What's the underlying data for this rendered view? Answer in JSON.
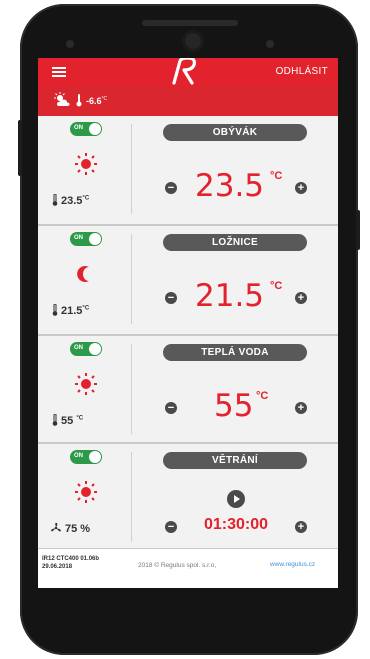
{
  "app": {
    "logo": "R",
    "logout_label": "ODHLÁSIT",
    "menu_icon": "hamburger-icon",
    "brand_color": "#e2222d"
  },
  "outdoor": {
    "temperature": "-6.6",
    "unit": "°C",
    "icon": "partly-cloudy-icon"
  },
  "zones": [
    {
      "name": "OBÝVÁK",
      "toggle": "ON",
      "mode_icon": "sun-icon",
      "current_temp": "23.5",
      "unit": "°C",
      "setpoint": "23.5",
      "setpoint_unit": "°C"
    },
    {
      "name": "LOŽNICE",
      "toggle": "ON",
      "mode_icon": "moon-icon",
      "current_temp": "21.5",
      "unit": "°C",
      "setpoint": "21.5",
      "setpoint_unit": "°C"
    },
    {
      "name": "TEPLÁ VODA",
      "toggle": "ON",
      "mode_icon": "sun-icon",
      "current_temp": "55",
      "unit": "°C",
      "setpoint": "55",
      "setpoint_unit": "°C"
    },
    {
      "name": "VĚTRÁNÍ",
      "toggle": "ON",
      "mode_icon": "sun-icon",
      "fan_value": "75 %",
      "timer": "01:30:00"
    }
  ],
  "footer": {
    "version": "IR12 CTC400 01.06b",
    "date": "29.06.2018",
    "copyright": "2018 © Regulus spol. s.r.o,",
    "website": "www.regulus.cz"
  },
  "buttons": {
    "minus": "−",
    "plus": "+"
  }
}
